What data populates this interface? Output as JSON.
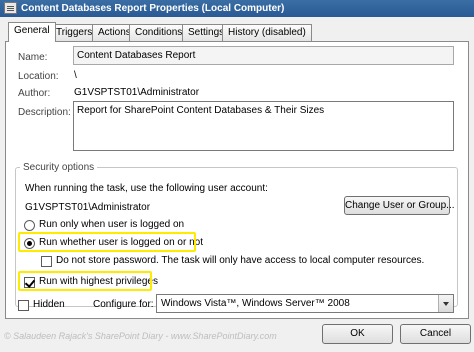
{
  "window": {
    "title": "Content Databases Report Properties (Local Computer)"
  },
  "tabs": [
    {
      "label": "General",
      "active": true
    },
    {
      "label": "Triggers",
      "active": false
    },
    {
      "label": "Actions",
      "active": false
    },
    {
      "label": "Conditions",
      "active": false
    },
    {
      "label": "Settings",
      "active": false
    },
    {
      "label": "History (disabled)",
      "active": false
    }
  ],
  "general": {
    "name_label": "Name:",
    "name_value": "Content Databases Report",
    "location_label": "Location:",
    "location_value": "\\",
    "author_label": "Author:",
    "author_value": "G1VSPTST01\\Administrator",
    "description_label": "Description:",
    "description_value": "Report for SharePoint Content Databases & Their Sizes"
  },
  "security": {
    "group_title": "Security options",
    "account_prompt": "When running the task, use the following user account:",
    "account_value": "G1VSPTST01\\Administrator",
    "change_user_button": "Change User or Group...",
    "radio_logged_on": "Run only when user is logged on",
    "radio_logged_on_checked": false,
    "radio_whether": "Run whether user is logged on or not",
    "radio_whether_checked": true,
    "no_store_password": "Do not store password.  The task will only have access to local computer resources.",
    "no_store_password_checked": false,
    "highest_privileges": "Run with highest privileges",
    "highest_privileges_checked": true
  },
  "footer": {
    "hidden_label": "Hidden",
    "hidden_checked": false,
    "configure_label": "Configure for:",
    "configure_value": "Windows Vista™, Windows Server™ 2008",
    "ok_button": "OK",
    "cancel_button": "Cancel"
  },
  "watermark": "© Salaudeen Rajack's SharePoint Diary - www.SharePointDiary.com",
  "colors": {
    "titlebar": "#3a6ea5",
    "highlight": "#ffeb00"
  }
}
